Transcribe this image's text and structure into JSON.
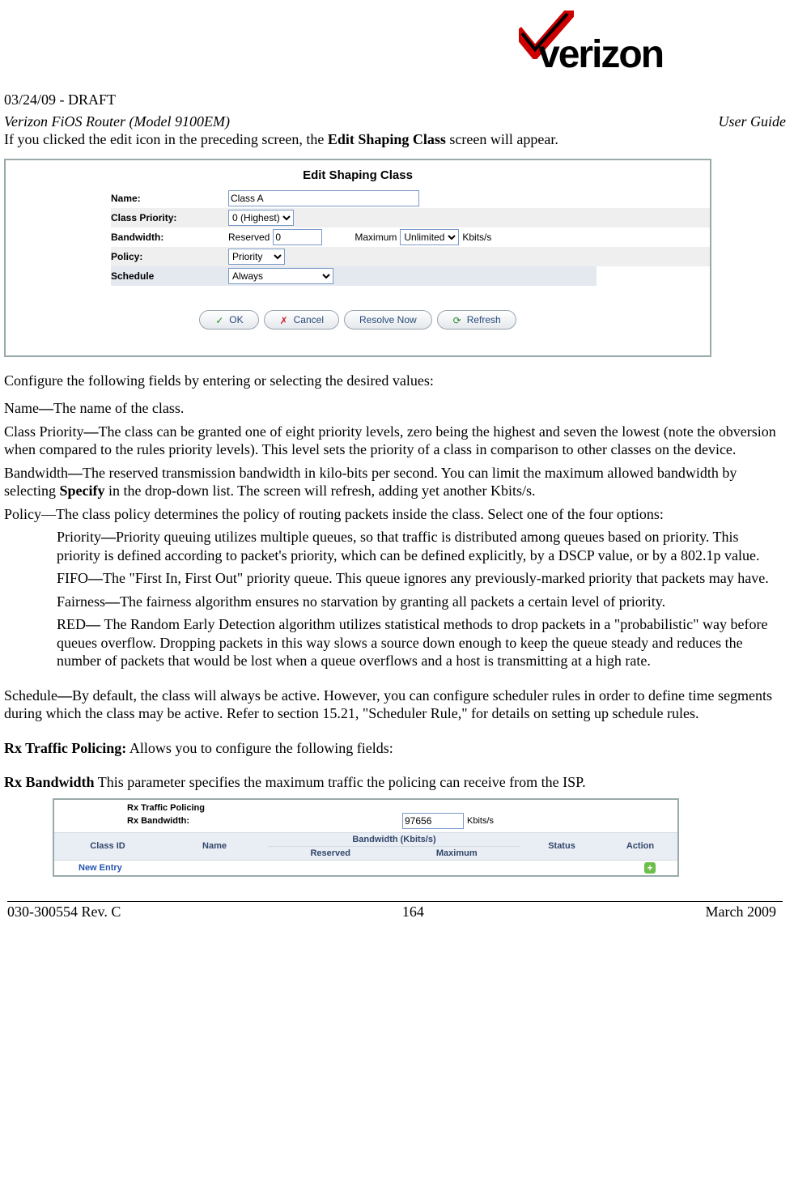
{
  "header": {
    "draft_line": "03/24/09 - DRAFT",
    "title_left": "Verizon FiOS Router (Model 9100EM)",
    "title_right": "User Guide",
    "logo_word": "verizon"
  },
  "intro_line_prefix": "If you clicked the edit icon in the preceding screen, the ",
  "intro_line_bold": "Edit Shaping Class",
  "intro_line_suffix": " screen will appear.",
  "form": {
    "title": "Edit Shaping Class",
    "labels": {
      "name": "Name:",
      "priority": "Class Priority:",
      "bandwidth": "Bandwidth:",
      "policy": "Policy:",
      "schedule": "Schedule"
    },
    "values": {
      "name": "Class A",
      "priority": "0 (Highest)",
      "bw_reserved_label": "Reserved",
      "bw_reserved_value": "0",
      "bw_maximum_label": "Maximum",
      "bw_maximum_value": "Unlimited",
      "bw_unit": "Kbits/s",
      "policy": "Priority",
      "schedule": "Always"
    },
    "buttons": {
      "ok": "OK",
      "cancel": "Cancel",
      "resolve": "Resolve Now",
      "refresh": "Refresh"
    }
  },
  "body": {
    "configure": "Configure the following fields by entering or selecting the desired values:",
    "name_prefix": "Name",
    "name_dash": "—",
    "name_text": "The name of the class.",
    "cp_prefix": "Class Priority",
    "cp_text": "The class can be granted one of eight priority levels, zero being the highest and seven the lowest (note the obversion when compared to the rules priority levels). This level sets the priority of a class in comparison to other classes on the device.",
    "bw_prefix": "Bandwidth",
    "bw_text_a": "The reserved transmission bandwidth in kilo-bits per second. You can limit the maximum allowed bandwidth by selecting ",
    "bw_text_bold": "Specify",
    "bw_text_b": " in the drop-down list. The screen will refresh, adding yet another Kbits/s.",
    "pol_prefix": "Policy",
    "pol_text": "—The class policy determines the policy of routing packets inside the class. Select one of the four options:",
    "opt_priority_prefix": "Priority",
    "opt_priority_text": "Priority queuing utilizes multiple queues, so that traffic is distributed among queues based on priority. This priority is defined according to packet's priority, which can be defined explicitly, by a DSCP value, or by a 802.1p value.",
    "opt_fifo_prefix": "FIFO",
    "opt_fifo_text": "The \"First In, First Out\" priority queue. This queue ignores any previously-marked priority that packets may have.",
    "opt_fair_prefix": "Fairness",
    "opt_fair_text": "The fairness algorithm ensures no starvation by granting all packets a certain level of priority.",
    "opt_red_prefix": "RED",
    "opt_red_dash": "— ",
    "opt_red_text": "The Random Early Detection algorithm utilizes statistical methods to drop packets in a \"probabilistic\" way before queues overflow. Dropping packets in this way slows a source down enough to keep the queue steady and reduces the number of packets that would be lost when a queue overflows and a host is transmitting at a high rate.",
    "sched_prefix": "Schedule",
    "sched_text": "By default, the class will always be active. However, you can configure scheduler rules in order to define time segments during which the class may be active. Refer to section 15.21, \"Scheduler Rule,\" for details on setting up schedule rules.",
    "rx_header_bold": "Rx Traffic Policing:",
    "rx_header_text": " Allows you to configure the following fields:",
    "rx_bw_bold": "Rx Bandwidth",
    "rx_bw_text": " This parameter specifies the maximum traffic the policing can receive from the ISP."
  },
  "rx": {
    "section_title": "Rx Traffic Policing",
    "bw_label": "Rx Bandwidth:",
    "bw_value": "97656",
    "bw_unit": "Kbits/s",
    "cols": {
      "class_id": "Class ID",
      "name": "Name",
      "bw_group": "Bandwidth (Kbits/s)",
      "reserved": "Reserved",
      "maximum": "Maximum",
      "status": "Status",
      "action": "Action"
    },
    "new_entry": "New Entry"
  },
  "footer": {
    "left": "030-300554 Rev. C",
    "center": "164",
    "right": "March 2009"
  },
  "chart_data": {
    "type": "table",
    "title": "Rx Traffic Policing",
    "rx_bandwidth_kbits": 97656,
    "columns": [
      "Class ID",
      "Name",
      "Bandwidth Reserved (Kbits/s)",
      "Bandwidth Maximum (Kbits/s)",
      "Status",
      "Action"
    ],
    "rows": [
      [
        "New Entry",
        "",
        "",
        "",
        "",
        "add"
      ]
    ]
  }
}
